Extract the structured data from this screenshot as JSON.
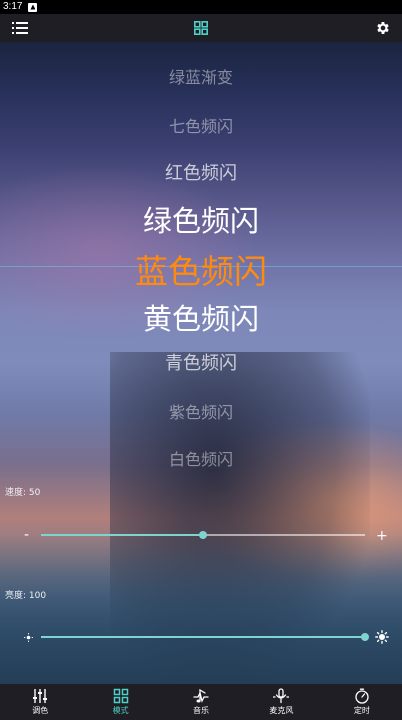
{
  "status": {
    "time": "3:17"
  },
  "colors": {
    "accent": "#4fd0c8",
    "selected_mode": "#ff8a10",
    "slider": "#7fd3d0"
  },
  "modes": [
    {
      "label": "绿蓝渐变"
    },
    {
      "label": "七色频闪"
    },
    {
      "label": "红色频闪"
    },
    {
      "label": "绿色频闪"
    },
    {
      "label": "蓝色频闪"
    },
    {
      "label": "黄色频闪"
    },
    {
      "label": "青色频闪"
    },
    {
      "label": "紫色频闪"
    },
    {
      "label": "白色频闪"
    }
  ],
  "selected_mode": "蓝色频闪",
  "speed": {
    "label": "速度: 50",
    "value": 50,
    "max": 100,
    "minus": "-",
    "plus": "+"
  },
  "brightness": {
    "label": "亮度: 100",
    "value": 100,
    "max": 100
  },
  "nav": [
    {
      "label": "调色",
      "icon": "equalizer-icon"
    },
    {
      "label": "模式",
      "icon": "grid-icon",
      "active": true
    },
    {
      "label": "音乐",
      "icon": "music-note-icon"
    },
    {
      "label": "麦克风",
      "icon": "microphone-icon"
    },
    {
      "label": "定时",
      "icon": "timer-icon"
    }
  ]
}
